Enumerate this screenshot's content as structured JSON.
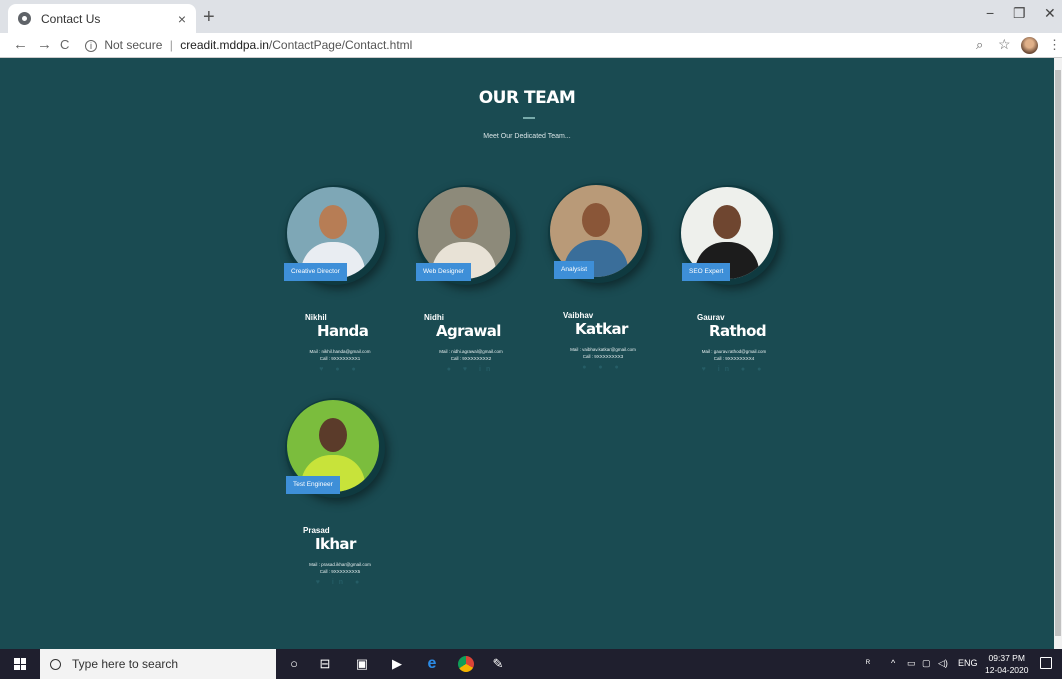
{
  "browser": {
    "tab_title": "Contact Us",
    "tab_close": "×",
    "new_tab": "+",
    "not_secure": "Not secure",
    "url_host": "creadit.mddpa.in",
    "url_path": "/ContactPage/Contact.html",
    "minimize": "−",
    "restore": "❐",
    "close": "✕",
    "back": "←",
    "forward": "→",
    "reload": "C",
    "zoom_icon": "zoom-icon",
    "star": "☆",
    "menu": "⋮"
  },
  "page": {
    "title": "OUR TEAM",
    "subtitle": "Meet Our Dedicated Team...",
    "background": "#1a4b52",
    "accent": "#3e8fd8"
  },
  "members": [
    {
      "first": "Nikhil",
      "last": "Handa",
      "role": "Creative Director",
      "mail": "Mail : nikhil.handa@gmail.com",
      "call": "Call : 9XXXXXXXX1",
      "socials": "♥ ● ●",
      "photo_bg": "#7ea7b6",
      "skin": "#b77d55",
      "shirt": "#e9edf2"
    },
    {
      "first": "Nidhi",
      "last": "Agrawal",
      "role": "Web Designer",
      "mail": "Mail : nidhi.agrawal@gmail.com",
      "call": "Call : 9XXXXXXXX2",
      "socials": "● ♥ in",
      "photo_bg": "#8d8a7a",
      "skin": "#9b6646",
      "shirt": "#e8e2d6"
    },
    {
      "first": "Vaibhav",
      "last": "Katkar",
      "role": "Analysist",
      "mail": "Mail : vaibhav.katkar@gmail.com",
      "call": "Call : 9XXXXXXXX3",
      "socials": "● ● ●",
      "photo_bg": "#b99a78",
      "skin": "#8a5638",
      "shirt": "#3a6e9a"
    },
    {
      "first": "Gaurav",
      "last": "Rathod",
      "role": "SEO Expert",
      "mail": "Mail : gaurav.rathod@gmail.com",
      "call": "Call : 9XXXXXXXX4",
      "socials": "♥ in ● ●",
      "photo_bg": "#eef0ec",
      "skin": "#6f4630",
      "shirt": "#1c1c1c"
    },
    {
      "first": "Prasad",
      "last": "Ikhar",
      "role": "Test Engineer",
      "mail": "Mail : prasad.ikhar@gmail.com",
      "call": "Call : 9XXXXXXXX5",
      "socials": "♥ in ●",
      "photo_bg": "#7bbd3d",
      "skin": "#5b3b2a",
      "shirt": "#c8e33a"
    }
  ],
  "taskbar": {
    "search_placeholder": "Type here to search",
    "language": "ENG",
    "time": "09:37 PM",
    "date": "12-04-2020",
    "icons": [
      "cortana-icon",
      "task-view-icon",
      "store-icon",
      "media-icon",
      "edge-icon",
      "chrome-icon",
      "paint-icon"
    ]
  }
}
